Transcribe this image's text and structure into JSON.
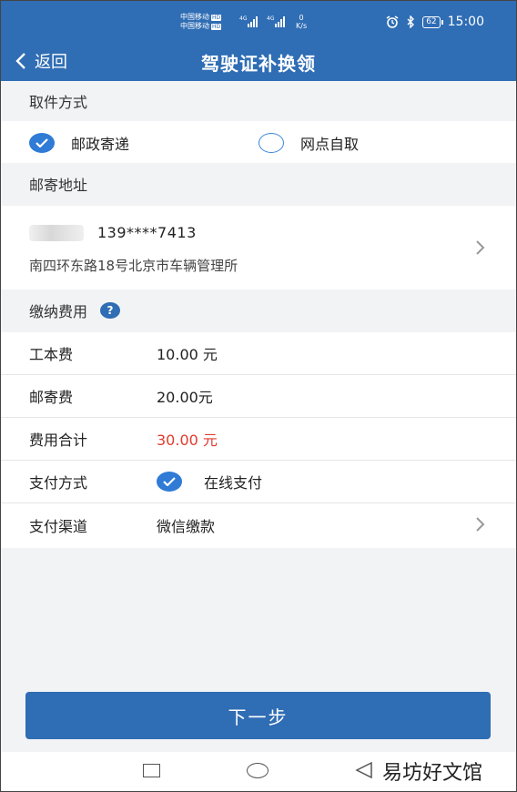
{
  "status_bar": {
    "carrier1": "中国移动",
    "carrier2": "中国移动",
    "hd": "HD",
    "net1": "4G",
    "net2": "4G",
    "speed_value": "0",
    "speed_unit": "K/s",
    "battery": "62",
    "time": "15:00"
  },
  "nav": {
    "back_label": "返回",
    "title": "驾驶证补换领"
  },
  "pickup": {
    "heading": "取件方式",
    "option_mail": "邮政寄递",
    "option_self": "网点自取",
    "selected": "邮政寄递"
  },
  "mail_address": {
    "heading": "邮寄地址",
    "phone": "139****7413",
    "address": "南四环东路18号北京市车辆管理所"
  },
  "fees": {
    "heading": "缴纳费用",
    "help": "?",
    "rows": [
      {
        "label": "工本费",
        "value": "10.00 元"
      },
      {
        "label": "邮寄费",
        "value": "20.00元"
      },
      {
        "label": "费用合计",
        "value": "30.00 元"
      },
      {
        "label": "支付方式",
        "value": "在线支付"
      },
      {
        "label": "支付渠道",
        "value": "微信缴款"
      }
    ]
  },
  "next_button": "下一步",
  "watermark": "易坊好文馆",
  "colors": {
    "primary": "#2f6db4",
    "check": "#2f7bd6",
    "total": "#e03b2e",
    "background": "#f2f3f5"
  }
}
